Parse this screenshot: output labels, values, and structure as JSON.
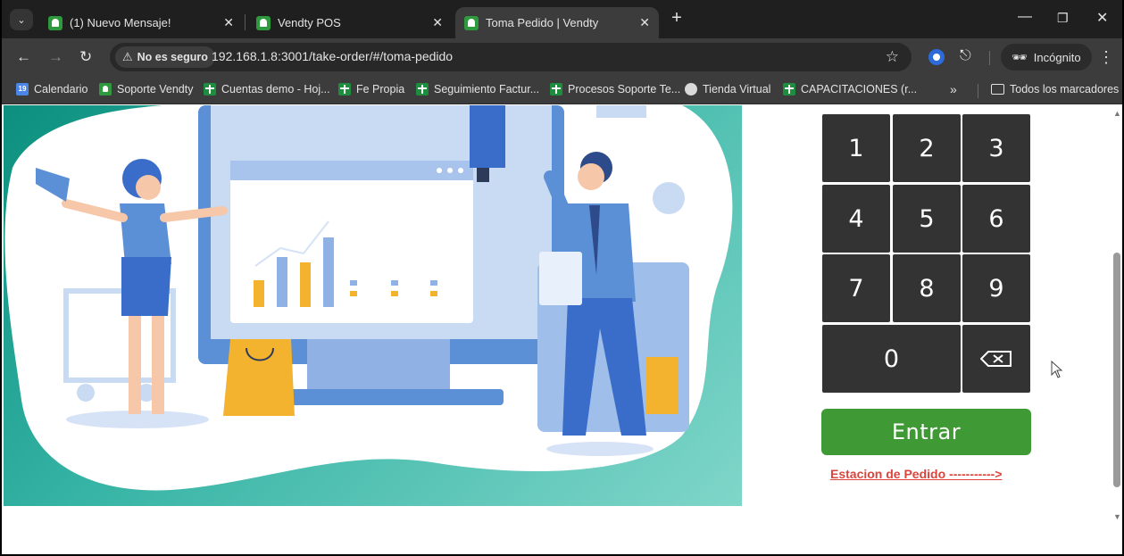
{
  "browser": {
    "tabs": [
      {
        "title": "(1) Nuevo Mensaje!",
        "active": false
      },
      {
        "title": "Vendty POS",
        "active": false
      },
      {
        "title": "Toma Pedido | Vendty",
        "active": true
      }
    ],
    "security_label": "No es seguro",
    "url": "192.168.1.8:3001/take-order/#/toma-pedido",
    "incognito_label": "Incógnito",
    "bookmarks": [
      {
        "label": "Calendario",
        "icon": "calendar-icon"
      },
      {
        "label": "Soporte Vendty",
        "icon": "vendty-icon"
      },
      {
        "label": "Cuentas demo - Hoj...",
        "icon": "sheets-icon"
      },
      {
        "label": "Fe Propia",
        "icon": "sheets-icon"
      },
      {
        "label": "Seguimiento Factur...",
        "icon": "sheets-icon"
      },
      {
        "label": "Procesos Soporte Te...",
        "icon": "sheets-icon"
      },
      {
        "label": "Tienda Virtual",
        "icon": "globe-icon"
      },
      {
        "label": "CAPACITACIONES (r...",
        "icon": "sheets-icon"
      }
    ],
    "all_bookmarks_label": "Todos los marcadores"
  },
  "keypad": {
    "keys": [
      "1",
      "2",
      "3",
      "4",
      "5",
      "6",
      "7",
      "8",
      "9",
      "0"
    ]
  },
  "enter_label": "Entrar",
  "station_link": "Estacion de Pedido ----------->",
  "colors": {
    "key_bg": "#333333",
    "enter_bg": "#3f9a35",
    "link_color": "#d9443c",
    "hero_teal": "#0c8f7e"
  }
}
